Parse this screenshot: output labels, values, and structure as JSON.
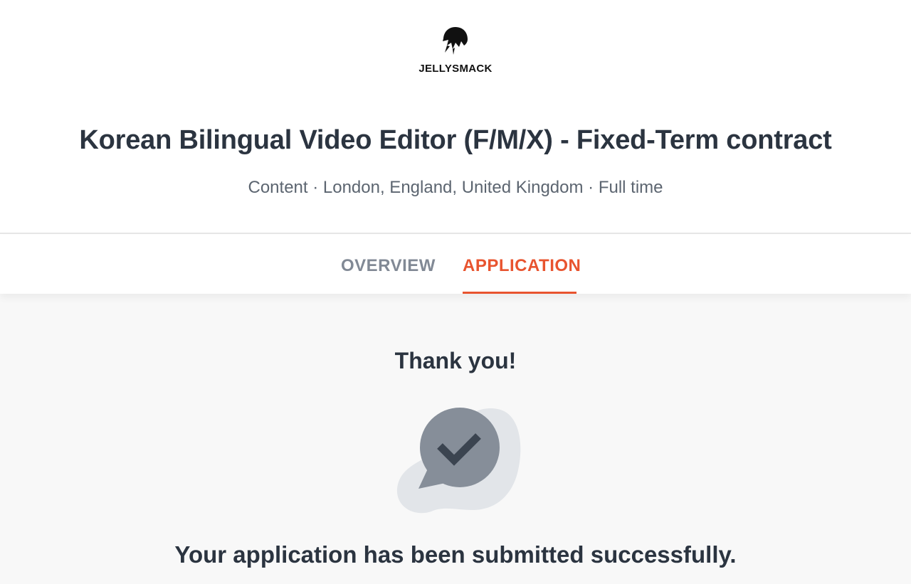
{
  "brand": {
    "name": "JELLYSMACK",
    "logo_icon": "jellyfish-logo-icon"
  },
  "job": {
    "title": "Korean Bilingual Video Editor (F/M/X) - Fixed-Term contract",
    "meta": "Content · London, England, United Kingdom · Full time"
  },
  "tabs": [
    {
      "label": "OVERVIEW",
      "active": false
    },
    {
      "label": "APPLICATION",
      "active": true
    }
  ],
  "confirmation": {
    "heading": "Thank you!",
    "icon": "chat-checkmark-icon",
    "message": "Your application has been submitted successfully."
  },
  "colors": {
    "accent": "#e8542f",
    "text_primary": "#2b3440",
    "text_secondary": "#5c6570",
    "tab_inactive": "#818995",
    "bubble": "#868e99",
    "bubble_shadow": "#e2e5e9",
    "check": "#3b4450"
  }
}
